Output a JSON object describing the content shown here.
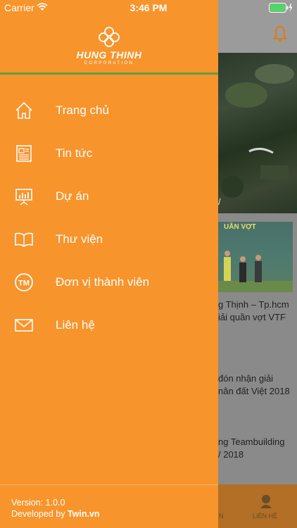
{
  "status_bar": {
    "carrier": "Carrier",
    "time": "3:46 PM"
  },
  "drawer": {
    "brand": {
      "name": "HUNG THINH",
      "subtitle": "CORPORATION"
    },
    "menu": [
      {
        "label": "Trang chủ",
        "icon": "home-icon"
      },
      {
        "label": "Tin tức",
        "icon": "newspaper-icon"
      },
      {
        "label": "Dự án",
        "icon": "presentation-board-icon"
      },
      {
        "label": "Thư viện",
        "icon": "book-icon"
      },
      {
        "label": "Đơn vị thành viên",
        "icon": "tm-badge-icon"
      },
      {
        "label": "Liên hệ",
        "icon": "envelope-icon"
      }
    ],
    "footer": {
      "version": "Version: 1.0.0",
      "developed_prefix": "Developed by ",
      "developer": "Twin.vn"
    }
  },
  "background": {
    "caption1": "/",
    "photo2_banner": "UẦN VỢT",
    "text_lines_1": [
      "g Thịnh – Tp.hcm",
      "iải quần vợt VTF"
    ],
    "text_lines_2": [
      "đón nhận giải",
      "nân đất Việt 2018"
    ],
    "text_lines_3": [
      "ng Teambuilding",
      "/ 2018"
    ],
    "tab_label_left": "N",
    "tab_label": "LIÊN HỆ"
  },
  "colors": {
    "drawer": "#f7942c",
    "accent_line": "#5aa14a",
    "tabbar": "#b26f25"
  }
}
